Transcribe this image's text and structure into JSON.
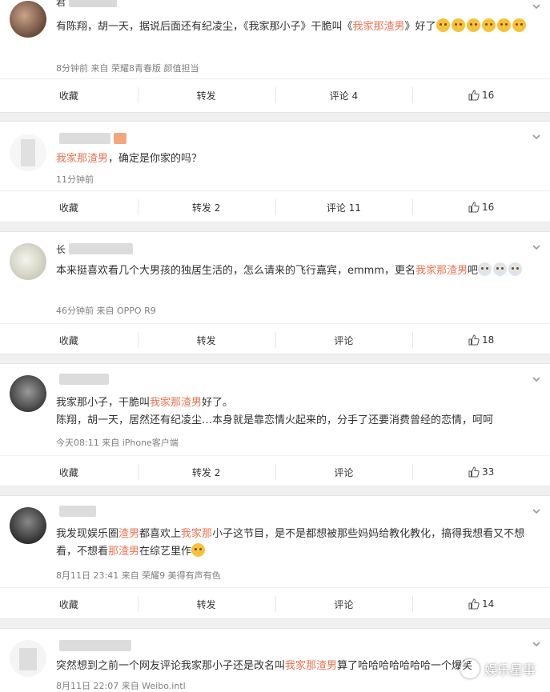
{
  "colors": {
    "accent": "#eb7350",
    "meta": "#808080",
    "background": "#f0f0f0"
  },
  "icons": {
    "more": "chevron-down-icon",
    "like": "thumbs-up-icon",
    "avatar": "avatar"
  },
  "comments": [
    {
      "name": "君",
      "content": [
        "有陈翔，胡一天，据说后面还有纪凌尘，《我家那小子》干脆叫《",
        "我家那渣男",
        "》好了"
      ],
      "meta": "8分钟前 来自 荣耀8青春版 颜值担当",
      "collect": "收藏",
      "repost": "转发",
      "comment": "评论 4",
      "likes": "16"
    },
    {
      "name": "",
      "content": [
        "",
        "我家那渣男",
        "，确定是你家的吗？"
      ],
      "meta": "11分钟前",
      "collect": "收藏",
      "repost": "转发 2",
      "comment": "评论 11",
      "likes": "16"
    },
    {
      "name": "长",
      "content": [
        "本来挺喜欢看几个大男孩的独居生活的，怎么请来的飞行嘉宾，emmm，更名",
        "我家那渣男",
        "吧"
      ],
      "meta": "46分钟前 来自 OPPO R9",
      "collect": "收藏",
      "repost": "转发",
      "comment": "评论",
      "likes": "18"
    },
    {
      "name": "",
      "content": [
        "我家那小子，干脆叫",
        "我家那渣男",
        "好了。"
      ],
      "content2": "陈翔，胡一天，居然还有纪凌尘…本身就是靠恋情火起来的，分手了还要消费曾经的恋情，呵呵",
      "meta": "今天08:11 来自 iPhone客户端",
      "collect": "收藏",
      "repost": "转发 2",
      "comment": "评论",
      "likes": "33"
    },
    {
      "name": "",
      "content": [
        "我发现娱乐圈",
        "渣男",
        "都喜欢上",
        "我家那",
        "小子这节目，是不是都想被那些妈妈给教化教化，搞得我想看又不想看，不想看",
        "那渣男",
        "在综艺里作"
      ],
      "meta": "8月11日 23:41 来自 荣耀9 美得有声有色",
      "collect": "收藏",
      "repost": "转发",
      "comment": "评论",
      "likes": "14"
    },
    {
      "name": "",
      "content": [
        "突然想到之前一个网友评论我家那小子还是改名叫",
        "我家那渣男",
        "算了哈哈哈哈哈哈哈一个爆笑"
      ],
      "meta": "8月11日 22:07 来自 Weibo.intl"
    }
  ],
  "watermark": "娱乐星事"
}
